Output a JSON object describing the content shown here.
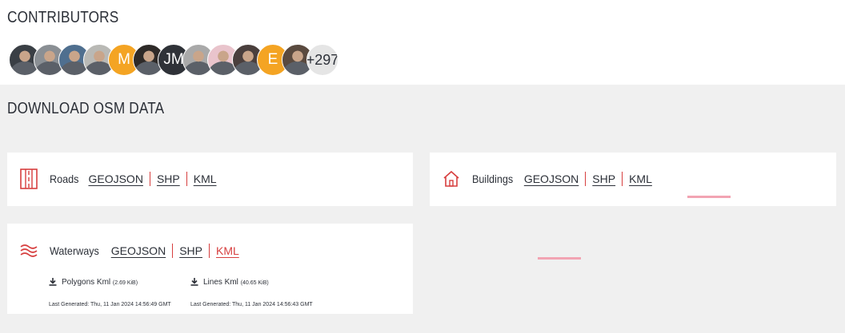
{
  "contributors": {
    "title": "CONTRIBUTORS",
    "avatars": [
      {
        "type": "photo",
        "color": "#3a3f45"
      },
      {
        "type": "photo",
        "color": "#8a8f94"
      },
      {
        "type": "photo",
        "color": "#4f6f8f"
      },
      {
        "type": "photo",
        "color": "#b9b9b5"
      },
      {
        "type": "initial",
        "initial": "M",
        "color": "#f4a423"
      },
      {
        "type": "photo",
        "color": "#2e2a28"
      },
      {
        "type": "initial",
        "initial": "JM",
        "color": "#2f3238"
      },
      {
        "type": "photo",
        "color": "#a9a9a9"
      },
      {
        "type": "photo",
        "color": "#e9c4cc"
      },
      {
        "type": "photo",
        "color": "#4a3f3d"
      },
      {
        "type": "initial",
        "initial": "E",
        "color": "#f4a423"
      },
      {
        "type": "photo",
        "color": "#5a4a3f"
      }
    ],
    "more_count": "+297"
  },
  "download": {
    "title": "DOWNLOAD OSM DATA",
    "layers": {
      "roads": {
        "name": "Roads",
        "formats": [
          "GEOJSON",
          "SHP",
          "KML"
        ],
        "icon": "road-icon"
      },
      "buildings": {
        "name": "Buildings",
        "formats": [
          "GEOJSON",
          "SHP",
          "KML"
        ],
        "icon": "house-icon"
      },
      "waterways": {
        "name": "Waterways",
        "formats": [
          "GEOJSON",
          "SHP",
          "KML"
        ],
        "active_format": "KML",
        "icon": "waves-icon",
        "files": [
          {
            "label": "Polygons Kml",
            "size": "(2.69 KiB)",
            "generated": "Last Generated: Thu, 11 Jan 2024 14:56:49 GMT"
          },
          {
            "label": "Lines Kml",
            "size": "(40.65 KiB)",
            "generated": "Last Generated: Thu, 11 Jan 2024 14:56:43 GMT"
          }
        ]
      }
    }
  },
  "colors": {
    "accent": "#d73f3f",
    "panel_bg": "#f0f0f0",
    "loading_bar": "#f2a4b3"
  }
}
